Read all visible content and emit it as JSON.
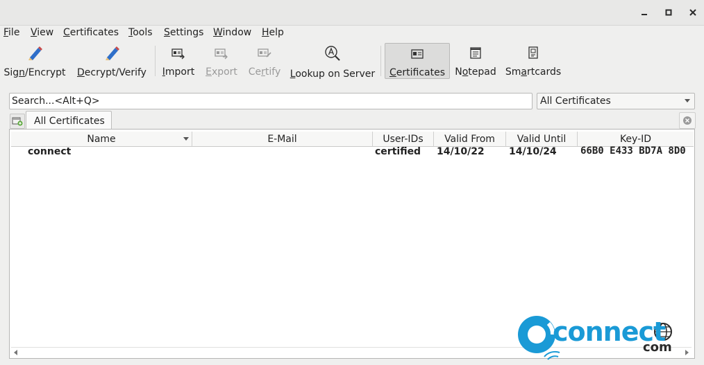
{
  "window": {
    "controls": [
      "minimize",
      "maximize",
      "close"
    ]
  },
  "menu": [
    {
      "mnemonic": "F",
      "rest": "ile"
    },
    {
      "mnemonic": "V",
      "rest": "iew"
    },
    {
      "mnemonic": "C",
      "rest": "ertificates"
    },
    {
      "mnemonic": "T",
      "rest": "ools"
    },
    {
      "mnemonic": "S",
      "rest": "ettings"
    },
    {
      "mnemonic": "W",
      "rest": "indow"
    },
    {
      "mnemonic": "H",
      "rest": "elp"
    }
  ],
  "toolbar": [
    {
      "pre": "Sig",
      "mnemonic": "n",
      "rest": "/Encrypt",
      "icon": "pen-icon",
      "enabled": true
    },
    {
      "pre": "",
      "mnemonic": "D",
      "rest": "ecrypt/Verify",
      "icon": "pen-icon",
      "enabled": true
    },
    {
      "pre": "",
      "mnemonic": "I",
      "rest": "mport",
      "icon": "certificate-import-icon",
      "enabled": true
    },
    {
      "pre": "",
      "mnemonic": "E",
      "rest": "xport",
      "icon": "certificate-export-icon",
      "enabled": false
    },
    {
      "pre": "Ce",
      "mnemonic": "r",
      "rest": "tify",
      "icon": "certify-icon",
      "enabled": false
    },
    {
      "pre": "",
      "mnemonic": "L",
      "rest": "ookup on Server",
      "icon": "lookup-icon",
      "enabled": true
    },
    {
      "pre": "",
      "mnemonic": "C",
      "rest": "ertificates",
      "icon": "certificates-icon",
      "enabled": true,
      "active": true
    },
    {
      "pre": "N",
      "mnemonic": "o",
      "rest": "tepad",
      "icon": "notepad-icon",
      "enabled": true
    },
    {
      "pre": "Sm",
      "mnemonic": "a",
      "rest": "rtcards",
      "icon": "smartcard-icon",
      "enabled": true
    }
  ],
  "search": {
    "placeholder": "Search...<Alt+Q>"
  },
  "filter": {
    "selected": "All Certificates"
  },
  "tabs": [
    {
      "label": "All Certificates"
    }
  ],
  "table": {
    "columns": [
      "Name",
      "E-Mail",
      "User-IDs",
      "Valid From",
      "Valid Until",
      "Key-ID"
    ],
    "rows": [
      {
        "name": "connect",
        "email": "",
        "user_ids": "certified",
        "valid_from": "14/10/22",
        "valid_until": "14/10/24",
        "key_id": "66B0 E433 BD7A 8D0"
      }
    ]
  },
  "watermark": {
    "main": "connect",
    "sub": "com"
  },
  "colors": {
    "accent": "#1a9ad6",
    "toolbar_active": "#dcdcdb",
    "disabled_text": "#9a9a9a"
  }
}
